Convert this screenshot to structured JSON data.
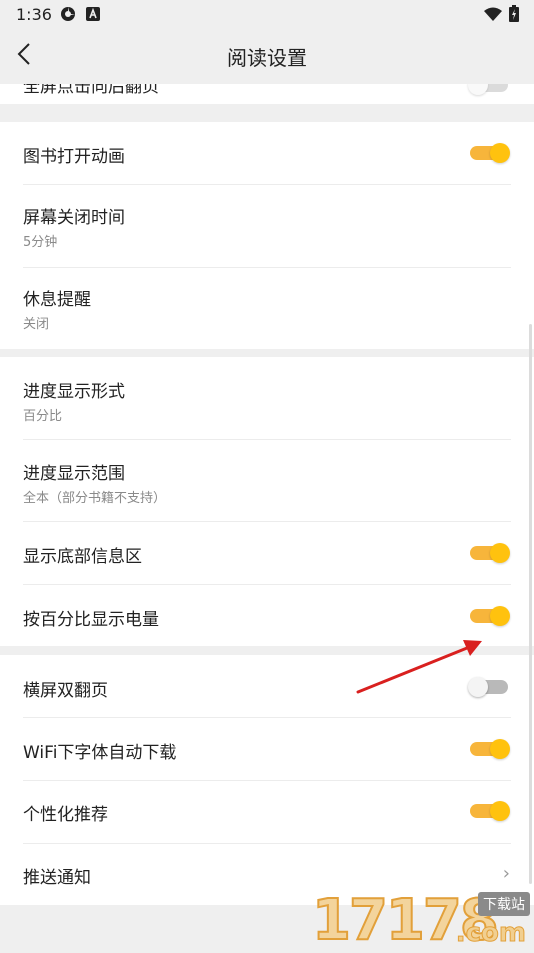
{
  "status": {
    "time": "1:36",
    "icon_a": "settings-gear-icon",
    "icon_b": "a-badge-icon",
    "wifi": "wifi-icon",
    "battery": "battery-charging-icon"
  },
  "header": {
    "title": "阅读设置",
    "back_icon": "chevron-left-icon"
  },
  "partial_row": {
    "title": "全屏点击向后翻页"
  },
  "group1": [
    {
      "title": "图书打开动画",
      "toggle": true
    },
    {
      "title": "屏幕关闭时间",
      "subtitle": "5分钟"
    },
    {
      "title": "休息提醒",
      "subtitle": "关闭"
    }
  ],
  "group2": [
    {
      "title": "进度显示形式",
      "subtitle": "百分比"
    },
    {
      "title": "进度显示范围",
      "subtitle": "全本（部分书籍不支持）"
    },
    {
      "title": "显示底部信息区",
      "toggle": true
    },
    {
      "title": "按百分比显示电量",
      "toggle": true
    }
  ],
  "group3": [
    {
      "title": "横屏双翻页",
      "toggle": false
    },
    {
      "title": "WiFi下字体自动下载",
      "toggle": true
    },
    {
      "title": "个性化推荐",
      "toggle": true
    },
    {
      "title": "推送通知",
      "chevron": "›"
    }
  ],
  "watermark": {
    "digits": "17178",
    "tag": "下载站",
    "suffix": ".com"
  },
  "colors": {
    "accent": "#ffc20e",
    "track_on": "#f7b53b",
    "track_off": "#b9b9b9",
    "annotation_arrow": "#d9201f"
  }
}
